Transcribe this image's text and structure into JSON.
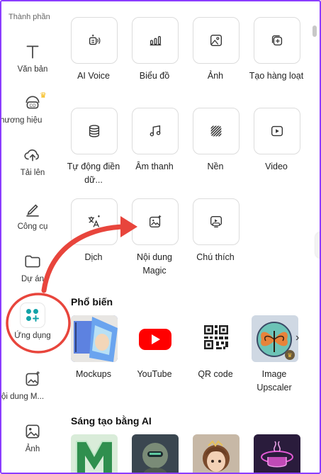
{
  "sidebar": {
    "top_label": "Thành phần",
    "items": [
      {
        "label": "Văn bản",
        "icon": "text-icon"
      },
      {
        "label": "hương hiệu",
        "icon": "brand-icon"
      },
      {
        "label": "Tải lên",
        "icon": "upload-icon"
      },
      {
        "label": "Công cụ",
        "icon": "draw-icon"
      },
      {
        "label": "Dự án",
        "icon": "folder-icon"
      },
      {
        "label": "Ứng dụng",
        "icon": "apps-icon"
      },
      {
        "label": "ội dung M...",
        "icon": "magic-media-icon"
      },
      {
        "label": "Ảnh",
        "icon": "photo-icon"
      }
    ]
  },
  "tools": [
    {
      "label": "AI Voice",
      "icon": "ai-voice-icon"
    },
    {
      "label": "Biểu đồ",
      "icon": "chart-icon"
    },
    {
      "label": "Ảnh",
      "icon": "image-icon"
    },
    {
      "label": "Tạo hàng loạt",
      "icon": "bulk-create-icon"
    },
    {
      "label": "Tự động điền dữ...",
      "icon": "database-icon"
    },
    {
      "label": "Âm thanh",
      "icon": "music-icon"
    },
    {
      "label": "Nền",
      "icon": "background-icon"
    },
    {
      "label": "Video",
      "icon": "video-icon"
    },
    {
      "label": "Dịch",
      "icon": "translate-icon"
    },
    {
      "label": "Nội dung Magic",
      "icon": "magic-icon"
    },
    {
      "label": "Chú thích",
      "icon": "caption-icon"
    }
  ],
  "popular": {
    "title": "Phổ biến",
    "apps": [
      {
        "label": "Mockups"
      },
      {
        "label": "YouTube"
      },
      {
        "label": "QR code"
      },
      {
        "label": "Image Upscaler"
      }
    ]
  },
  "ai_section": {
    "title": "Sáng tạo bằng AI"
  },
  "colors": {
    "accent": "#8b3dff",
    "annotation_red": "#e8453c",
    "youtube_red": "#ff0000"
  }
}
